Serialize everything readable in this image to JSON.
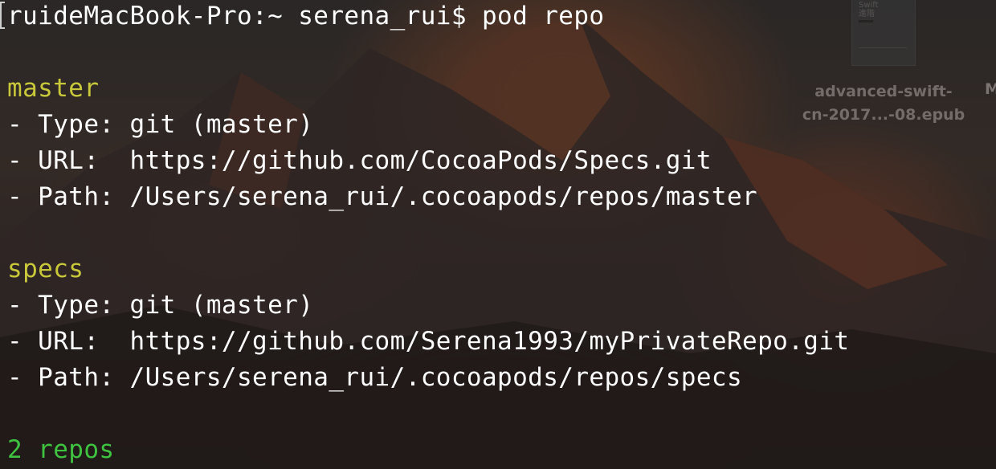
{
  "terminal": {
    "prompt": "ruideMacBook-Pro:~ serena_rui$ pod repo",
    "repos": [
      {
        "name": "master",
        "type_line": "- Type: git (master)",
        "url_line": "- URL:  https://github.com/CocoaPods/Specs.git",
        "path_line": "- Path: /Users/serena_rui/.cocoapods/repos/master"
      },
      {
        "name": "specs",
        "type_line": "- Type: git (master)",
        "url_line": "- URL:  https://github.com/Serena1993/myPrivateRepo.git",
        "path_line": "- Path: /Users/serena_rui/.cocoapods/repos/specs"
      }
    ],
    "summary": "2 repos"
  },
  "desktop": {
    "file_thumb_text": "Swift\n進階",
    "file_label_line1": "advanced-swift-",
    "file_label_line2": "cn-2017...-08.epub",
    "edge_label": "M"
  },
  "colors": {
    "text": "#ffffff",
    "repo_name": "#c8c83a",
    "summary": "#3fc23f"
  }
}
